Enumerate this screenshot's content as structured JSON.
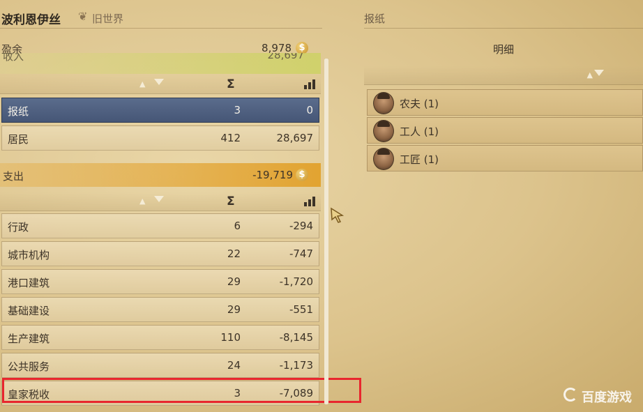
{
  "header": {
    "city_name": "波利恩伊丝",
    "region_icon": "laurel-icon",
    "region_name": "旧世界",
    "right_title": "报纸"
  },
  "balance": {
    "label": "盈余",
    "value": "8,978",
    "currency_icon": "dollar-coin-icon"
  },
  "income": {
    "label": "收入",
    "value": "28,697",
    "rows": [
      {
        "name": "报纸",
        "count": "3",
        "amount": "0",
        "selected": true
      },
      {
        "name": "居民",
        "count": "412",
        "amount": "28,697",
        "selected": false
      }
    ]
  },
  "expense": {
    "label": "支出",
    "value": "-19,719",
    "rows": [
      {
        "name": "行政",
        "count": "6",
        "amount": "-294"
      },
      {
        "name": "城市机构",
        "count": "22",
        "amount": "-747"
      },
      {
        "name": "港口建筑",
        "count": "29",
        "amount": "-1,720"
      },
      {
        "name": "基础建设",
        "count": "29",
        "amount": "-551"
      },
      {
        "name": "生产建筑",
        "count": "110",
        "amount": "-8,145"
      },
      {
        "name": "公共服务",
        "count": "24",
        "amount": "-1,173"
      },
      {
        "name": "皇家税收",
        "count": "3",
        "amount": "-7,089"
      }
    ]
  },
  "columns": {
    "sum_icon": "Σ",
    "chart_icon": "bar-chart-icon"
  },
  "detail": {
    "title": "明细",
    "rows": [
      {
        "name": "农夫 (1)",
        "icon": "farmer-avatar-icon"
      },
      {
        "name": "工人 (1)",
        "icon": "worker-avatar-icon"
      },
      {
        "name": "工匠 (1)",
        "icon": "artisan-avatar-icon"
      }
    ]
  },
  "watermark": {
    "text": "百度游戏"
  },
  "colors": {
    "selected_row": "#4f6080",
    "highlight_box": "#e8262e",
    "income_band": "#cfd26a",
    "expense_band": "#e2a028"
  }
}
